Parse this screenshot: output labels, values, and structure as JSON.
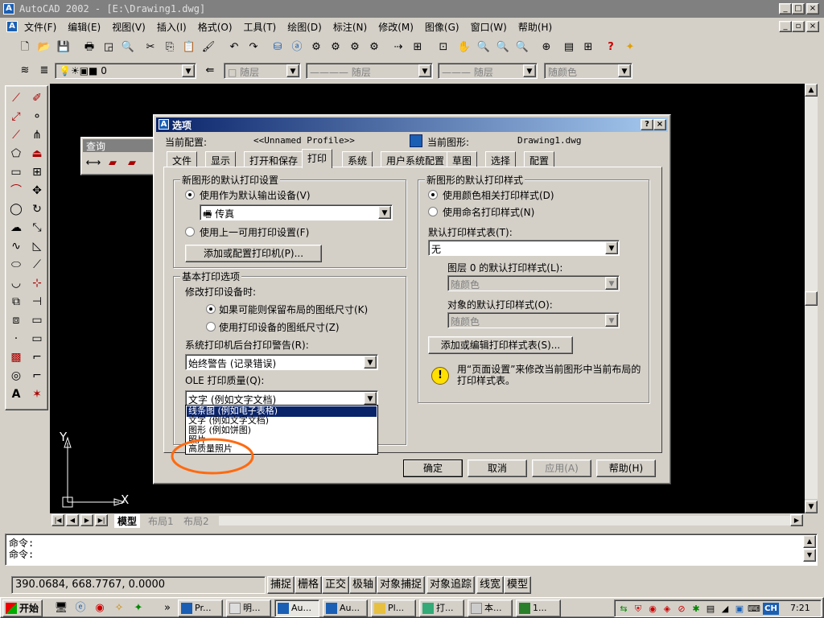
{
  "window": {
    "title": "AutoCAD 2002 - [E:\\Drawing1.dwg]",
    "buttons": [
      "_",
      "□",
      "×"
    ]
  },
  "menu": [
    "文件(F)",
    "编辑(E)",
    "视图(V)",
    "插入(I)",
    "格式(O)",
    "工具(T)",
    "绘图(D)",
    "标注(N)",
    "修改(M)",
    "图像(G)",
    "窗口(W)",
    "帮助(H)"
  ],
  "layers_toolbar": {
    "layer_value": "0",
    "color_value": "随层",
    "linetype_value": "随层",
    "lineweight_value": "随层",
    "plotstyle_value": "随颜色"
  },
  "query_toolbar": {
    "title": "查询"
  },
  "dialog": {
    "title": "选项",
    "profile_label": "当前配置:",
    "profile_value": "<<Unnamed Profile>>",
    "drawing_label": "当前图形:",
    "drawing_value": "Drawing1.dwg",
    "tabs": [
      "文件",
      "显示",
      "打开和保存",
      "打印",
      "系统",
      "用户系统配置",
      "草图",
      "选择",
      "配置"
    ],
    "active_tab": "打印",
    "new_drawing_group": {
      "title": "新图形的默认打印设置",
      "radio_default": "使用作为默认输出设备(V)",
      "device_value": "传真",
      "radio_last": "使用上一可用打印设置(F)",
      "add_button": "添加或配置打印机(P)..."
    },
    "basic_group": {
      "title": "基本打印选项",
      "change_label": "修改打印设备时:",
      "radio_keep": "如果可能则保留布局的图纸尺寸(K)",
      "radio_use": "使用打印设备的图纸尺寸(Z)",
      "spool_label": "系统打印机后台打印警告(R):",
      "spool_value": "始终警告 (记录错误)",
      "ole_label": "OLE 打印质量(Q):",
      "ole_value": "文字 (例如文字文档)"
    },
    "plot_style_group": {
      "title": "新图形的默认打印样式",
      "radio_color": "使用颜色相关打印样式(D)",
      "radio_named": "使用命名打印样式(N)",
      "default_table_label": "默认打印样式表(T):",
      "default_table_value": "无",
      "layer0_label": "图层 0 的默认打印样式(L):",
      "layer0_value": "随颜色",
      "object_label": "对象的默认打印样式(O):",
      "object_value": "随颜色",
      "edit_button": "添加或编辑打印样式表(S)...",
      "info_text": "用“页面设置”来修改当前图形中当前布局的打印样式表。"
    },
    "buttons": {
      "ok": "确定",
      "cancel": "取消",
      "apply": "应用(A)",
      "help": "帮助(H)"
    },
    "dropdown_items": [
      "线条图 (例如电子表格)",
      "文字 (例如文字文档)",
      "图形 (例如饼图)",
      "照片",
      "高质量照片"
    ]
  },
  "layout_tabs": [
    "模型",
    "布局1",
    "布局2"
  ],
  "command_lines": [
    "命令:",
    "命令:"
  ],
  "coordinates": "390.0684, 668.7767, 0.0000",
  "status_buttons": [
    "捕捉",
    "栅格",
    "正交",
    "极轴",
    "对象捕捉",
    "对象追踪",
    "线宽",
    "模型"
  ],
  "ucs": {
    "x_label": "X",
    "y_label": "Y"
  },
  "taskbar": {
    "start": "开始",
    "tasks": [
      "Pr...",
      "明...",
      "Au...",
      "Au...",
      "Pl...",
      "打...",
      "本...",
      "1..."
    ],
    "clock": "7:21",
    "ime": "CH"
  }
}
